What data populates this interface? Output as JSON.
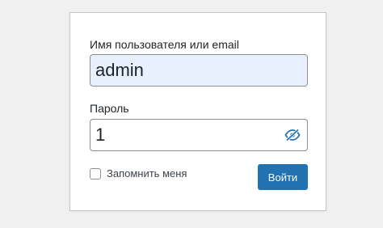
{
  "colors": {
    "page_background": "#f0f0f1",
    "form_background": "#ffffff",
    "autofill_background": "#e8f0fe",
    "accent": "#2271b1",
    "button_text": "#ffffff"
  },
  "login_form": {
    "username": {
      "label": "Имя пользователя или email",
      "value": "admin"
    },
    "password": {
      "label": "Пароль",
      "value": "1",
      "toggle_icon": "eye-slash-icon"
    },
    "remember": {
      "label": "Запомнить меня",
      "checked": false
    },
    "submit_label": "Войти"
  }
}
